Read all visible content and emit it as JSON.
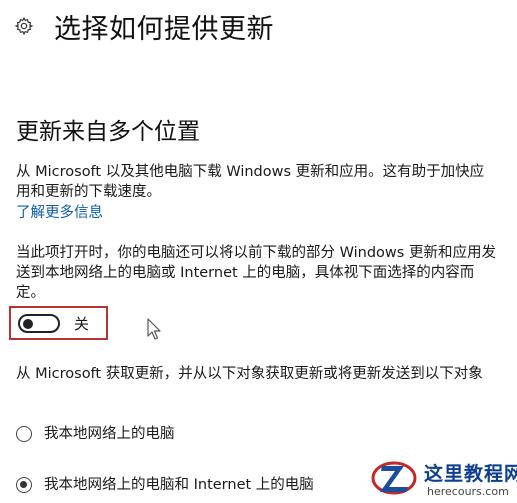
{
  "header": {
    "title": "选择如何提供更新",
    "icon": "gear-icon"
  },
  "section": {
    "title": "更新来自多个位置",
    "description_1": "从 Microsoft 以及其他电脑下载 Windows 更新和应用。这有助于加快应用和更新的下载速度。",
    "learn_more": "了解更多信息",
    "description_2": "当此项打开时，你的电脑还可以将以前下载的部分 Windows 更新和应用发送到本地网络上的电脑或 Internet 上的电脑，具体视下面选择的内容而定。"
  },
  "toggle": {
    "label": "关",
    "state": "off",
    "highlight_color": "#b83232"
  },
  "delivery": {
    "description": "从 Microsoft 获取更新，并从以下对象获取更新或将更新发送到以下对象",
    "options": [
      {
        "label": "我本地网络上的电脑",
        "selected": false
      },
      {
        "label": "我本地网络上的电脑和 Internet 上的电脑",
        "selected": true
      }
    ]
  },
  "watermark": {
    "name": "这里教程网",
    "url": "herecours.com"
  },
  "colors": {
    "link": "#0a5fa8",
    "text": "#1a1a1a",
    "watermark_text": "#0d3f8f"
  }
}
